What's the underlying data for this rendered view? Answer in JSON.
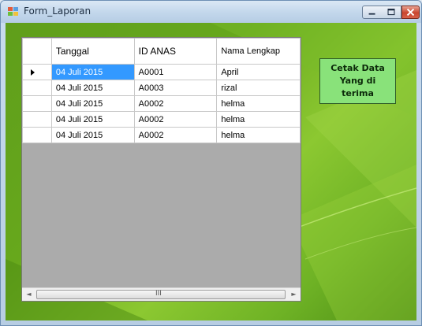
{
  "window": {
    "title": "Form_Laporan"
  },
  "grid": {
    "columns": [
      "Tanggal",
      "ID ANAS",
      "Nama Lengkap"
    ],
    "rows": [
      {
        "tanggal": "04 Juli 2015",
        "id_anas": "A0001",
        "nama": "April",
        "current": true
      },
      {
        "tanggal": "04 Juli 2015",
        "id_anas": "A0003",
        "nama": "rizal",
        "current": false
      },
      {
        "tanggal": "04 Juli 2015",
        "id_anas": "A0002",
        "nama": "helma",
        "current": false
      },
      {
        "tanggal": "04 Juli 2015",
        "id_anas": "A0002",
        "nama": "helma",
        "current": false
      },
      {
        "tanggal": "04 Juli 2015",
        "id_anas": "A0002",
        "nama": "helma",
        "current": false
      }
    ],
    "selected_cell": "04 Juli 2015",
    "scroll_grip": "III"
  },
  "button": {
    "print_label": "Cetak Data Yang di terima"
  },
  "colors": {
    "selection": "#3399ff",
    "button_bg": "#89e27a",
    "background_green": "#67a81c"
  },
  "icons": {
    "title": "form-icon",
    "minimize": "minimize-icon",
    "maximize": "maximize-icon",
    "close": "close-icon",
    "scroll_left": "scroll-left-arrow-icon",
    "scroll_right": "scroll-right-arrow-icon",
    "row_indicator": "current-row-arrow-icon"
  }
}
